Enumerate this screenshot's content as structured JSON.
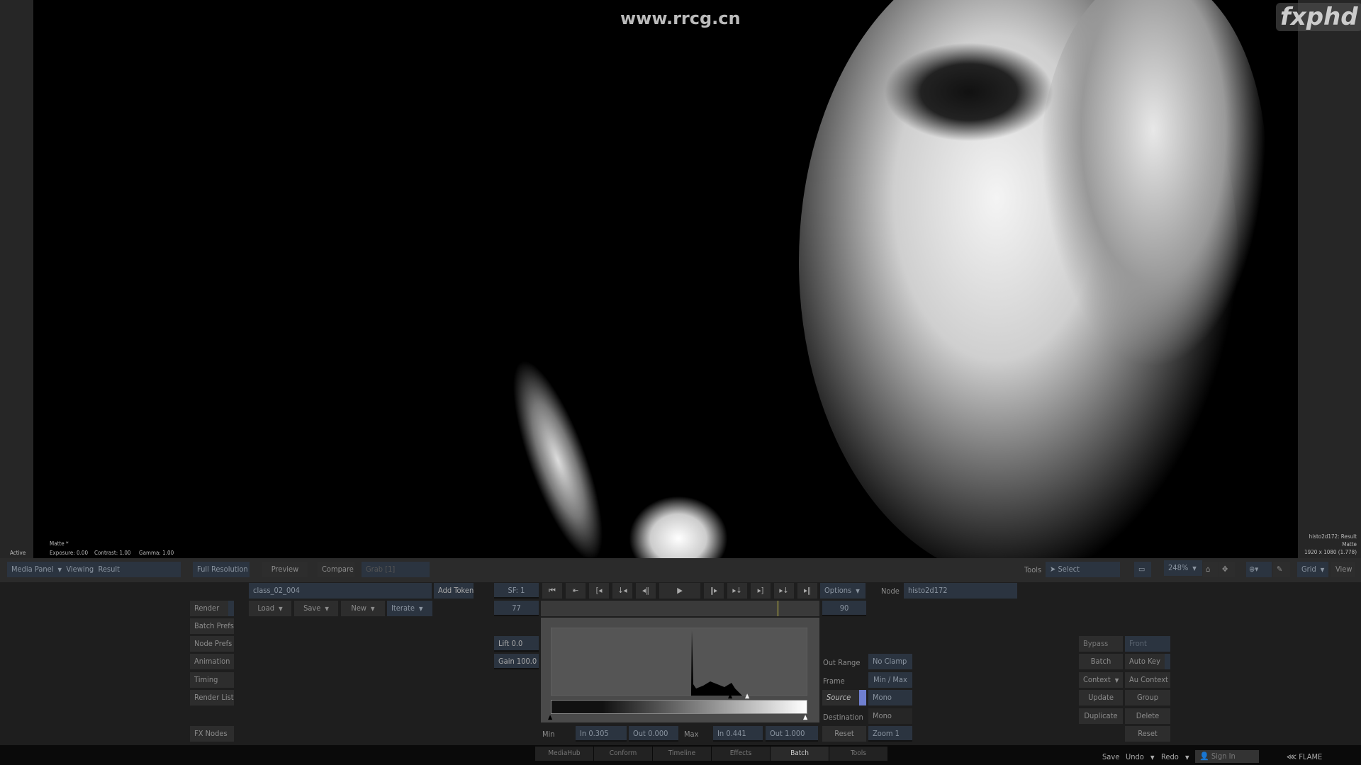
{
  "watermark": "www.rrcg.cn",
  "logo": "fxphd",
  "viewer": {
    "status": "Active",
    "channel": "Matte *",
    "exposure": "Exposure: 0.00",
    "contrast": "Contrast: 1.00",
    "gamma": "Gamma: 1.00",
    "node_info": "histo2d172: Result",
    "node_channel": "Matte",
    "resolution": "1920 x 1080 (1.778)"
  },
  "toolbar": {
    "media_panel": "Media Panel",
    "viewing": "Viewing",
    "result": "Result",
    "full_resolution": "Full Resolution",
    "preview": "Preview",
    "compare": "Compare",
    "grab": "Grab [1]",
    "tools": "Tools",
    "select": "Select",
    "zoom": "248%",
    "grid": "Grid",
    "view": "View"
  },
  "left_buttons": [
    "Render",
    "Batch Prefs",
    "Node Prefs",
    "Animation",
    "Timing",
    "Render List",
    "FX Nodes"
  ],
  "file": {
    "name": "class_02_004",
    "add_token": "Add Token",
    "load": "Load",
    "save": "Save",
    "new": "New",
    "iterate": "Iterate"
  },
  "transport": {
    "sf": "SF: 1",
    "start_frame": "77",
    "end_frame": "90",
    "buttons": [
      "⏮",
      "⇤",
      "[◂",
      "↓◂",
      "◂‖",
      "▶",
      "‖▸",
      "▸↓",
      "▸]",
      "▸↓",
      "▸‖"
    ],
    "options": "Options",
    "node_label": "Node",
    "node_name": "histo2d172"
  },
  "histogram": {
    "lift": "Lift 0.0",
    "gain": "Gain 100.0",
    "min_label": "Min",
    "min_in": "In 0.305",
    "min_out": "Out 0.000",
    "max_label": "Max",
    "max_in": "In 0.441",
    "max_out": "Out 1.000",
    "reset": "Reset",
    "zoom": "Zoom 1"
  },
  "settings": {
    "out_range_label": "Out Range",
    "out_range": "No Clamp",
    "frame_label": "Frame",
    "frame": "Min / Max",
    "source_label": "Source",
    "source": "Mono",
    "destination_label": "Destination",
    "destination": "Mono"
  },
  "right_buttons": {
    "bypass": "Bypass",
    "front": "Front",
    "batch": "Batch",
    "auto_key": "Auto Key",
    "context": "Context",
    "au_context": "Au Context",
    "update": "Update",
    "group": "Group",
    "duplicate": "Duplicate",
    "delete": "Delete",
    "reset": "Reset"
  },
  "tabs": [
    "MediaHub",
    "Conform",
    "Timeline",
    "Effects",
    "Batch",
    "Tools"
  ],
  "active_tab": "Batch",
  "status_bar": {
    "save": "Save",
    "undo": "Undo",
    "redo": "Redo",
    "sign_in": "Sign In",
    "app": "FLAME"
  },
  "colors": {
    "accent": "#6f7fd0",
    "panel": "#1e1e1e",
    "field": "#2b3440"
  }
}
